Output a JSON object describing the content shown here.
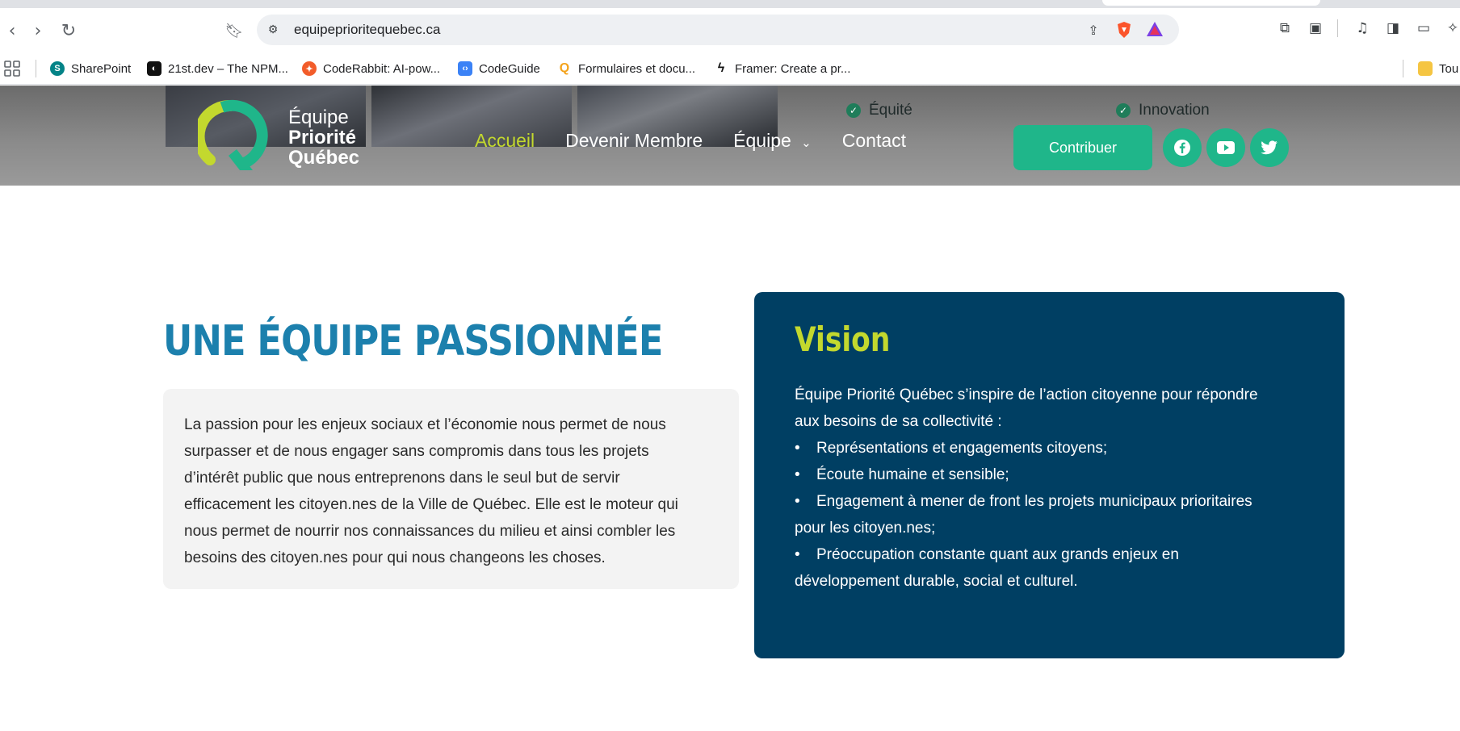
{
  "browser": {
    "url": "equipeprioritequebec.ca",
    "bookmarks": [
      {
        "label": "SharePoint"
      },
      {
        "label": "21st.dev – The NPM..."
      },
      {
        "label": "CodeRabbit: AI-pow..."
      },
      {
        "label": "CodeGuide"
      },
      {
        "label": "Formulaires et docu..."
      },
      {
        "label": "Framer: Create a pr..."
      },
      {
        "label": "Tou"
      }
    ]
  },
  "header": {
    "logo": {
      "line1": "Équipe",
      "line2": "Priorité",
      "line3": "Québec"
    },
    "values": [
      "Équité",
      "Innovation"
    ],
    "nav": [
      {
        "label": "Accueil",
        "active": true
      },
      {
        "label": "Devenir Membre"
      },
      {
        "label": "Équipe"
      },
      {
        "label": "Contact"
      }
    ],
    "cta_label": "Contribuer",
    "social": [
      "facebook-icon",
      "youtube-icon",
      "twitter-icon"
    ],
    "accent_color": "#c3d82e",
    "brand_color": "#1fb68a"
  },
  "main": {
    "title": "UNE ÉQUIPE PASSIONNÉE",
    "paragraph_lines": [
      "La passion pour les enjeux sociaux et l’économie nous permet de nous",
      "surpasser et de nous engager sans compromis dans tous les projets",
      "d’intérêt public que nous entreprenons dans le seul but de servir",
      "efficacement les citoyen.nes de la Ville de Québec. Elle est le moteur qui",
      "nous permet de nourrir nos connaissances du milieu et ainsi combler les",
      "besoins des citoyen.nes pour qui nous changeons les choses."
    ],
    "vision": {
      "title": "Vision",
      "intro_lines": [
        "Équipe Priorité Québec s’inspire de l’action citoyenne pour répondre",
        "aux besoins de sa collectivité :"
      ],
      "items": [
        {
          "line1": "Représentations et engagements citoyens;"
        },
        {
          "line1": "Écoute humaine et sensible;"
        },
        {
          "line1": "Engagement à mener de front les projets municipaux prioritaires",
          "line2": "pour les citoyen.nes;"
        },
        {
          "line1": "Préoccupation constante quant aux grands enjeux en",
          "line2": "développement durable, social et culturel."
        }
      ],
      "bg_color": "#003f63"
    }
  }
}
